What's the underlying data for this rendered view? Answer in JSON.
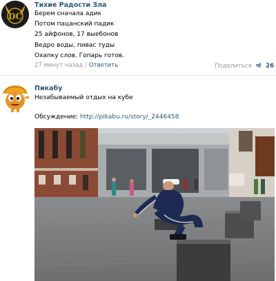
{
  "post1": {
    "author": "Тихие Радости Зла",
    "lines": [
      "Берем сначала адик",
      "Потом пацанский падик",
      "25 айфонов, 17 выебонов",
      "Ведро воды, пивас туды",
      "Охапку слов. Гопарь готов."
    ],
    "time": "27 минут назад",
    "separator": "|",
    "reply": "Ответить",
    "share_label": "Поделиться",
    "share_count": "26",
    "avatar_letters": "DC"
  },
  "post2": {
    "author": "Пикабу",
    "text": "Незабываемый отдых на кубе",
    "discussion_label": "Обсуждение: ",
    "discussion_link": "http://pikabu.ru/story/_2446458"
  },
  "colors": {
    "link": "#2b587a",
    "meta": "#999999",
    "divider": "#e7e8ec"
  }
}
